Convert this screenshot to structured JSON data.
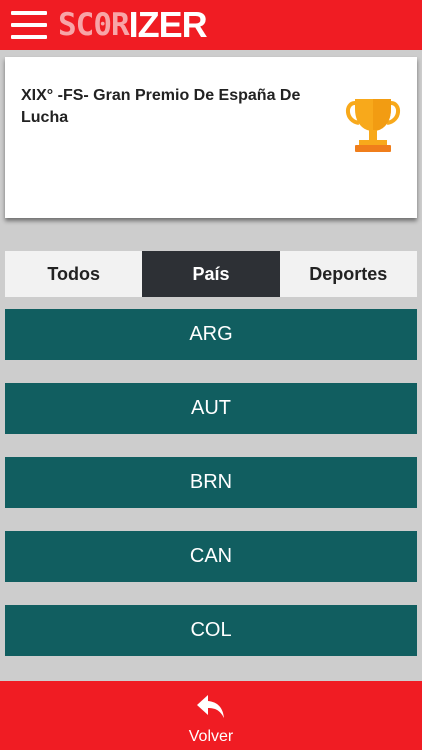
{
  "header": {
    "logo_part1": "SC0R",
    "logo_part2": "IZER",
    "icons": {
      "menu": "hamburger-menu-icon"
    }
  },
  "event": {
    "title": "XIX° -FS- Gran Premio De España De Lucha",
    "icon": "trophy-icon"
  },
  "tabs": [
    {
      "label": "Todos",
      "active": false
    },
    {
      "label": "País",
      "active": true
    },
    {
      "label": "Deportes",
      "active": false
    }
  ],
  "countries": [
    "ARG",
    "AUT",
    "BRN",
    "CAN",
    "COL"
  ],
  "footer": {
    "back_label": "Volver",
    "back_icon": "reply-arrow-icon"
  },
  "colors": {
    "header_red": "#f01c23",
    "country_teal": "#115e60",
    "active_tab": "#2d3035",
    "trophy_gold": "#f8a91b"
  }
}
